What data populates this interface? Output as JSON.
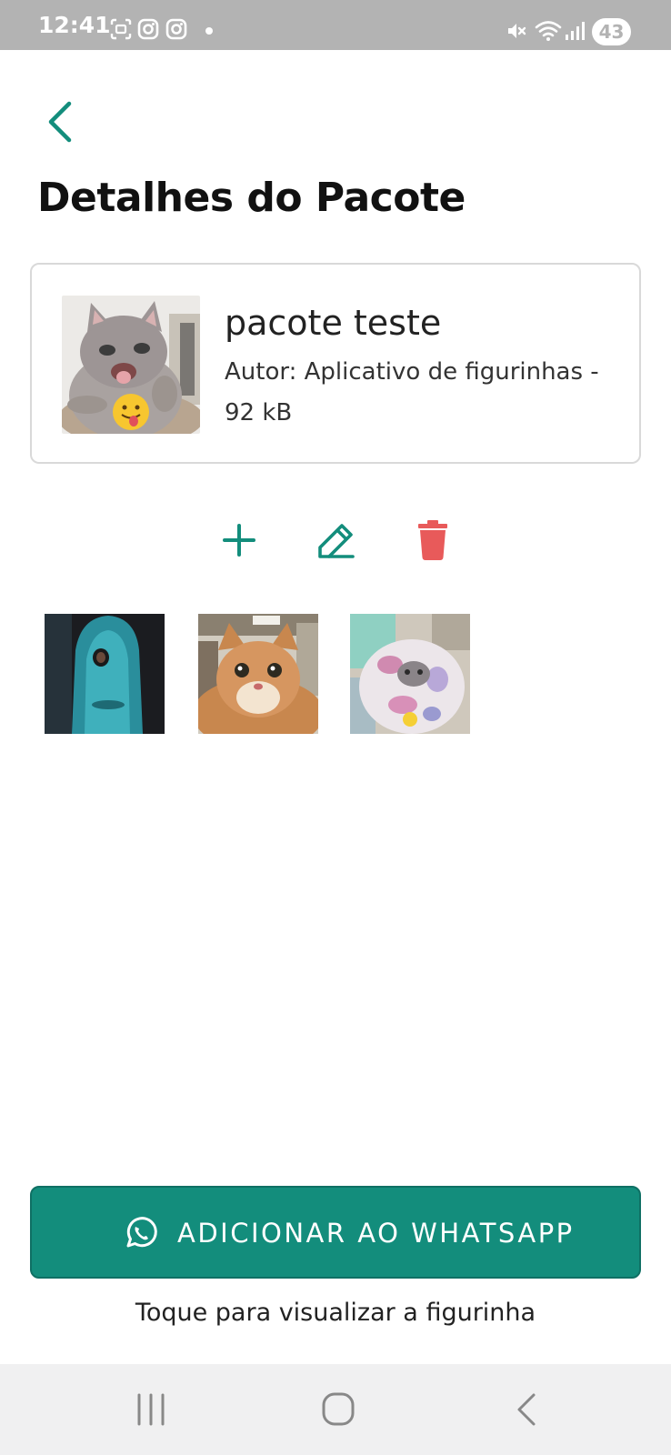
{
  "status_bar": {
    "time": "12:41",
    "battery": "43",
    "icons": [
      "screenshot-icon",
      "instagram-icon",
      "instagram-icon",
      "dot-icon",
      "mute-icon",
      "wifi-icon",
      "signal-icon",
      "battery-icon"
    ]
  },
  "header": {
    "back_icon": "chevron-left-icon",
    "title": "Detalhes do Pacote"
  },
  "pack": {
    "name": "pacote teste",
    "meta": "Autor: Aplicativo de figurinhas - 92 kB",
    "thumbnail": "kitten-with-tongue-emoji"
  },
  "actions": [
    {
      "name": "add-sticker",
      "icon": "plus-icon",
      "color": "#138d7c"
    },
    {
      "name": "edit-pack",
      "icon": "pencil-icon",
      "color": "#138d7c"
    },
    {
      "name": "delete-pack",
      "icon": "trash-icon",
      "color": "#e85a5a"
    }
  ],
  "stickers": [
    "blue-figure-sticker",
    "orange-cat-sticker",
    "tiedye-cat-sticker"
  ],
  "whatsapp_button": {
    "icon": "whatsapp-icon",
    "label": "ADICIONAR AO WHATSAPP",
    "color": "#138d7c"
  },
  "hint": "Toque para visualizar a figurinha",
  "nav_bar": {
    "buttons": [
      "recent-apps-icon",
      "home-icon",
      "back-icon"
    ]
  }
}
